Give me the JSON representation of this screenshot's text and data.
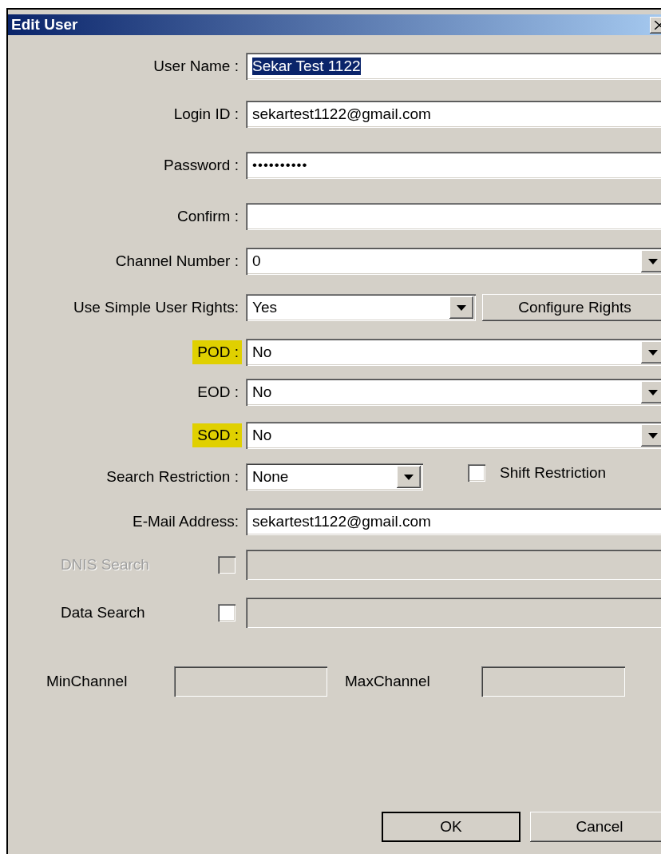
{
  "window": {
    "title": "Edit User"
  },
  "rows": [
    {
      "kind": "text",
      "label": "User Name :",
      "value": "Sekar Test 1122",
      "value_selected": true
    },
    {
      "kind": "text",
      "label": "Login ID :",
      "value": "sekartest1122@gmail.com",
      "value_selected": false
    },
    {
      "kind": "password",
      "label": "Password :",
      "value": "••••••••••"
    },
    {
      "kind": "text",
      "label": "Confirm :"
    },
    {
      "kind": "dropdown",
      "label": "Channel Number :",
      "value": "0",
      "highlighted": false
    },
    {
      "kind": "dropdown_button",
      "label": "Use Simple User Rights:",
      "value": "Yes",
      "button": "Configure Rights"
    },
    {
      "kind": "dropdown",
      "label": "POD :",
      "value": "No",
      "highlighted": true
    },
    {
      "kind": "dropdown",
      "label": "EOD :",
      "value": "No",
      "highlighted": false
    },
    {
      "kind": "dropdown",
      "label": "SOD :",
      "value": "No",
      "highlighted": true
    },
    {
      "kind": "dropdown_checkbox",
      "label": "Search Restriction :",
      "value": "None",
      "checkbox": {
        "label": "Shift Restriction",
        "checked": false
      }
    },
    {
      "kind": "text",
      "label": "E-Mail Address:",
      "value": "sekartest1122@gmail.com",
      "value_selected": false
    },
    {
      "kind": "checkbox_field",
      "label": "DNIS Search",
      "checked": false,
      "disabled": true
    },
    {
      "kind": "checkbox_field",
      "label": "Data Search",
      "checked": false,
      "disabled": false
    }
  ],
  "channels": [
    {
      "label": "MinChannel"
    },
    {
      "label": "MaxChannel"
    }
  ],
  "buttons": [
    {
      "label": "OK",
      "default": true
    },
    {
      "label": "Cancel",
      "default": false
    }
  ]
}
